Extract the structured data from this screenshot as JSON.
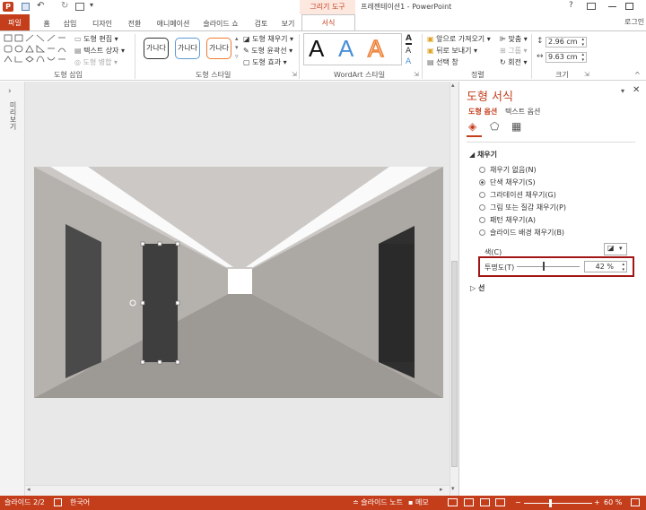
{
  "window": {
    "title": "프레젠테이션1 - PowerPoint",
    "context_tab": "그리기 도구",
    "user": "로그인"
  },
  "tabs": [
    "파일",
    "홈",
    "삽입",
    "디자인",
    "전환",
    "애니메이션",
    "슬라이드 쇼",
    "검토",
    "보기",
    "서식"
  ],
  "ribbon": {
    "insert_shapes": {
      "edit_shape": "도형 편집",
      "text_box": "텍스트 상자",
      "merge_shapes": "도형 병합",
      "label": "도형 삽입"
    },
    "shape_styles": {
      "style1": "가나다",
      "style2": "가나다",
      "style3": "가나다",
      "fill": "도형 채우기",
      "outline": "도형 윤곽선",
      "effects": "도형 효과",
      "label": "도형 스타일"
    },
    "wordart": {
      "letter": "A",
      "label": "WordArt 스타일"
    },
    "arrange": {
      "bring_forward": "앞으로 가져오기",
      "send_backward": "뒤로 보내기",
      "selection_pane": "선택 창",
      "align": "맞춤",
      "group": "그룹",
      "rotate": "회전",
      "label": "정렬"
    },
    "size": {
      "height": "2.96 cm",
      "width": "9.63 cm",
      "label": "크기"
    }
  },
  "left_panel": {
    "label": "미리보기"
  },
  "pane": {
    "title": "도형 서식",
    "tab_shape": "도형 옵션",
    "tab_text": "텍스트 옵션",
    "fill_header": "채우기",
    "options": [
      "채우기 없음(N)",
      "단색 채우기(S)",
      "그라데이션 채우기(G)",
      "그림 또는 질감 채우기(P)",
      "패턴 채우기(A)",
      "슬라이드 배경 채우기(B)"
    ],
    "selected_option_index": 1,
    "color_label": "색(C)",
    "transparency_label": "투명도(T)",
    "transparency_value": "42 %",
    "transparency_level": 0.42,
    "line_header": "선"
  },
  "status": {
    "slide": "슬라이드 2/2",
    "language": "한국어",
    "notes": "슬라이드 노트",
    "comments": "메모",
    "zoom": "60 %"
  },
  "colors": {
    "accent": "#c43e1c",
    "highlight": "#a31515"
  }
}
